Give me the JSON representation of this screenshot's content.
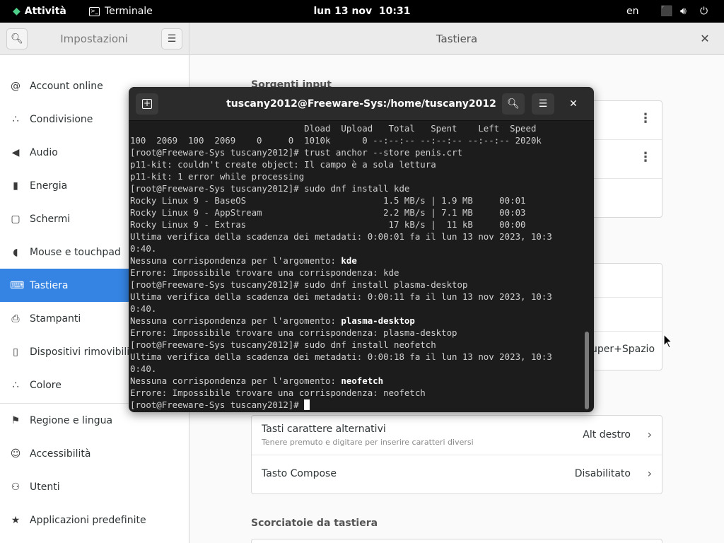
{
  "topbar": {
    "activities": "Attività",
    "app_name": "Terminale",
    "clock": "lun 13 nov  10:31",
    "language": "en"
  },
  "settings": {
    "sidebar_title": "Impostazioni",
    "page_title": "Tastiera",
    "sidebar_items": [
      {
        "label": "Account online",
        "icon": "at-icon"
      },
      {
        "label": "Condivisione",
        "icon": "share-icon"
      },
      {
        "label": "Audio",
        "icon": "speaker-icon"
      },
      {
        "label": "Energia",
        "icon": "battery-icon"
      },
      {
        "label": "Schermi",
        "icon": "display-icon"
      },
      {
        "label": "Mouse e touchpad",
        "icon": "mouse-icon"
      },
      {
        "label": "Tastiera",
        "icon": "keyboard-icon",
        "active": true
      },
      {
        "label": "Stampanti",
        "icon": "printer-icon"
      },
      {
        "label": "Dispositivi rimovibili",
        "icon": "usb-icon"
      },
      {
        "label": "Colore",
        "icon": "color-icon"
      },
      {
        "label": "Regione e lingua",
        "icon": "flag-icon"
      },
      {
        "label": "Accessibilità",
        "icon": "accessibility-icon"
      },
      {
        "label": "Utenti",
        "icon": "users-icon"
      },
      {
        "label": "Applicazioni predefinite",
        "icon": "star-icon"
      }
    ],
    "content": {
      "input_sources_title": "Sorgenti input",
      "switch_shortcut_partial": "uper+Spazio",
      "alt_chars": {
        "title": "Tasti carattere alternativi",
        "subtitle": "Tenere premuto e digitare per inserire caratteri diversi",
        "value": "Alt destro"
      },
      "compose": {
        "title": "Tasto Compose",
        "value": "Disabilitato"
      },
      "shortcuts_title": "Scorciatoie da tastiera"
    }
  },
  "terminal": {
    "title": "tuscany2012@Freeware-Sys:/home/tuscany2012",
    "lines": [
      "                                 Dload  Upload   Total   Spent    Left  Speed",
      "100  2069  100  2069    0     0  1010k      0 --:--:-- --:--:-- --:--:-- 2020k",
      "[root@Freeware-Sys tuscany2012]# trust anchor --store penis.crt",
      "p11-kit: couldn't create object: Il campo è a sola lettura",
      "p11-kit: 1 error while processing",
      "[root@Freeware-Sys tuscany2012]# sudo dnf install kde",
      "Rocky Linux 9 - BaseOS                          1.5 MB/s | 1.9 MB     00:01",
      "Rocky Linux 9 - AppStream                       2.2 MB/s | 7.1 MB     00:03",
      "Rocky Linux 9 - Extras                           17 kB/s |  11 kB     00:00",
      "Ultima verifica della scadenza dei metadati: 0:00:01 fa il lun 13 nov 2023, 10:3",
      "0:40.",
      "Nessuna corrispondenza per l'argomento: ",
      "Errore: Impossibile trovare una corrispondenza: kde",
      "[root@Freeware-Sys tuscany2012]# sudo dnf install plasma-desktop",
      "Ultima verifica della scadenza dei metadati: 0:00:11 fa il lun 13 nov 2023, 10:3",
      "0:40.",
      "Nessuna corrispondenza per l'argomento: ",
      "Errore: Impossibile trovare una corrispondenza: plasma-desktop",
      "[root@Freeware-Sys tuscany2012]# sudo dnf install neofetch",
      "Ultima verifica della scadenza dei metadati: 0:00:18 fa il lun 13 nov 2023, 10:3",
      "0:40.",
      "Nessuna corrispondenza per l'argomento: ",
      "Errore: Impossibile trovare una corrispondenza: neofetch",
      "[root@Freeware-Sys tuscany2012]# "
    ],
    "bold_args": {
      "11": "kde",
      "16": "plasma-desktop",
      "21": "neofetch"
    }
  }
}
